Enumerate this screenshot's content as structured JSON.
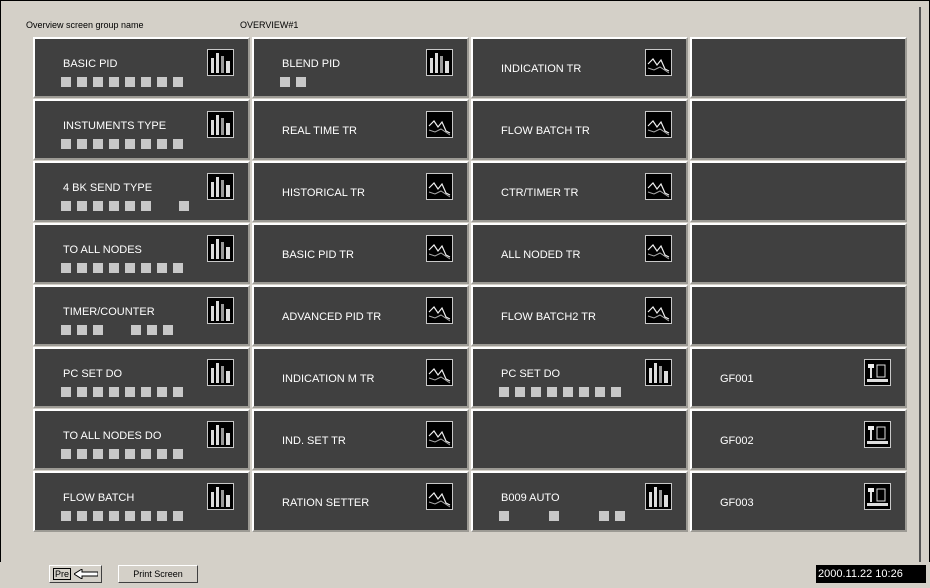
{
  "header": {
    "label": "Overview screen group name",
    "value": "OVERVIEW#1"
  },
  "panels": [
    {
      "id": "p00",
      "label": "BASIC PID",
      "icon": "bar-chart-icon",
      "squares": "8"
    },
    {
      "id": "p01",
      "label": "BLEND PID",
      "icon": "bar-chart-icon",
      "squares": "2"
    },
    {
      "id": "p02",
      "label": "INDICATION TR",
      "icon": "trend-icon",
      "squares": ""
    },
    {
      "id": "p03",
      "label": "",
      "icon": "",
      "squares": ""
    },
    {
      "id": "p10",
      "label": "INSTUMENTS TYPE",
      "icon": "bar-chart-icon",
      "squares": "8"
    },
    {
      "id": "p11",
      "label": "REAL TIME TR",
      "icon": "trend-icon",
      "squares": ""
    },
    {
      "id": "p12",
      "label": "FLOW BATCH TR",
      "icon": "trend-icon",
      "squares": ""
    },
    {
      "id": "p13",
      "label": "",
      "icon": "",
      "squares": ""
    },
    {
      "id": "p20",
      "label": "4 BK  SEND TYPE",
      "icon": "bar-chart-icon",
      "squares": "6+1"
    },
    {
      "id": "p21",
      "label": "HISTORICAL TR",
      "icon": "trend-icon",
      "squares": ""
    },
    {
      "id": "p22",
      "label": "CTR/TIMER TR",
      "icon": "trend-icon",
      "squares": ""
    },
    {
      "id": "p23",
      "label": "",
      "icon": "",
      "squares": ""
    },
    {
      "id": "p30",
      "label": "TO ALL NODES",
      "icon": "bar-chart-icon",
      "squares": "8"
    },
    {
      "id": "p31",
      "label": "BASIC PID TR",
      "icon": "trend-icon",
      "squares": ""
    },
    {
      "id": "p32",
      "label": "ALL NODED TR",
      "icon": "trend-icon",
      "squares": ""
    },
    {
      "id": "p33",
      "label": "",
      "icon": "",
      "squares": ""
    },
    {
      "id": "p40",
      "label": "TIMER/COUNTER",
      "icon": "bar-chart-icon",
      "squares": "3+3"
    },
    {
      "id": "p41",
      "label": "ADVANCED PID TR",
      "icon": "trend-icon",
      "squares": ""
    },
    {
      "id": "p42",
      "label": "FLOW BATCH2 TR",
      "icon": "trend-icon",
      "squares": ""
    },
    {
      "id": "p43",
      "label": "",
      "icon": "",
      "squares": ""
    },
    {
      "id": "p50",
      "label": "PC SET DO",
      "icon": "bar-chart-icon",
      "squares": "8"
    },
    {
      "id": "p51",
      "label": "INDICATION M TR",
      "icon": "trend-icon",
      "squares": ""
    },
    {
      "id": "p52",
      "label": "PC SET DO",
      "icon": "bar-chart-icon",
      "squares": "8"
    },
    {
      "id": "p53",
      "label": "GF001",
      "icon": "graphic-icon",
      "squares": ""
    },
    {
      "id": "p60",
      "label": "TO ALL NODES DO",
      "icon": "bar-chart-icon",
      "squares": "8"
    },
    {
      "id": "p61",
      "label": "IND. SET TR",
      "icon": "trend-icon",
      "squares": ""
    },
    {
      "id": "p62",
      "label": "",
      "icon": "",
      "squares": ""
    },
    {
      "id": "p63",
      "label": "GF002",
      "icon": "graphic-icon",
      "squares": ""
    },
    {
      "id": "p70",
      "label": "FLOW BATCH",
      "icon": "bar-chart-icon",
      "squares": "8"
    },
    {
      "id": "p71",
      "label": "RATION SETTER",
      "icon": "trend-icon",
      "squares": ""
    },
    {
      "id": "p72",
      "label": "B009 AUTO",
      "icon": "bar-chart-icon",
      "squares": "1+1+2"
    },
    {
      "id": "p73",
      "label": "GF003",
      "icon": "graphic-icon",
      "squares": ""
    }
  ],
  "statusbar": {
    "pre_label": "Pre",
    "back_icon": "back-arrow-icon",
    "print_label": "Print Screen",
    "datetime": "2000.11.22 10:26"
  }
}
